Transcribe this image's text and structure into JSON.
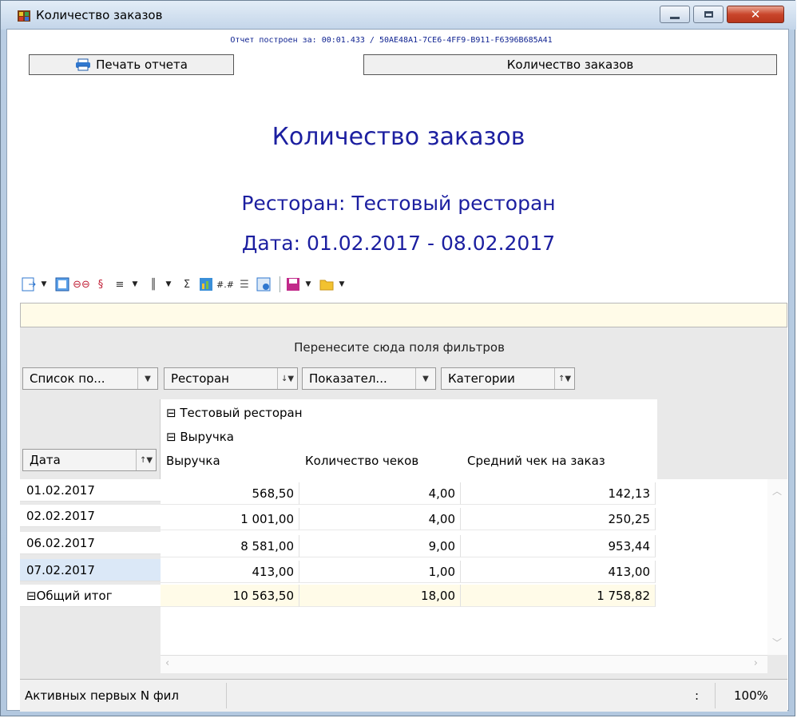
{
  "window": {
    "title": "Количество заказов"
  },
  "report": {
    "build_info": "Отчет построен за: 00:01.433 / 50AE48A1-7CE6-4FF9-B911-F6396B685A41",
    "print_button": "Печать отчета",
    "report_button": "Количество заказов",
    "title": "Количество заказов",
    "restaurant_line": "Ресторан: Тестовый ресторан",
    "date_line": "Дата: 01.02.2017 - 08.02.2017"
  },
  "pivot": {
    "filter_hint": "Перенесите сюда поля фильтров",
    "field_list": "Список по...",
    "field_restaurant": "Ресторан",
    "field_metrics": "Показател...",
    "field_categories": "Категории",
    "field_date": "Дата",
    "header_restaurant": "Тестовый ресторан",
    "header_group": "Выручка",
    "columns": [
      "Выручка",
      "Количество чеков",
      "Средний чек на заказ"
    ],
    "rows": [
      {
        "label": "01.02.2017",
        "values": [
          "568,50",
          "4,00",
          "142,13"
        ]
      },
      {
        "label": "02.02.2017",
        "values": [
          "1 001,00",
          "4,00",
          "250,25"
        ]
      },
      {
        "label": "06.02.2017",
        "values": [
          "8 581,00",
          "9,00",
          "953,44"
        ]
      },
      {
        "label": "07.02.2017",
        "values": [
          "413,00",
          "1,00",
          "413,00"
        ]
      }
    ],
    "total": {
      "label": "Общий итог",
      "values": [
        "10 563,50",
        "18,00",
        "1 758,82"
      ]
    }
  },
  "status": {
    "left": "Активных первых N фил",
    "colon": ":",
    "zoom": "100%"
  },
  "colors": {
    "title_blue": "#1c1fa0",
    "selected_row": "#dbe8f7",
    "total_row": "#fffbe8"
  }
}
